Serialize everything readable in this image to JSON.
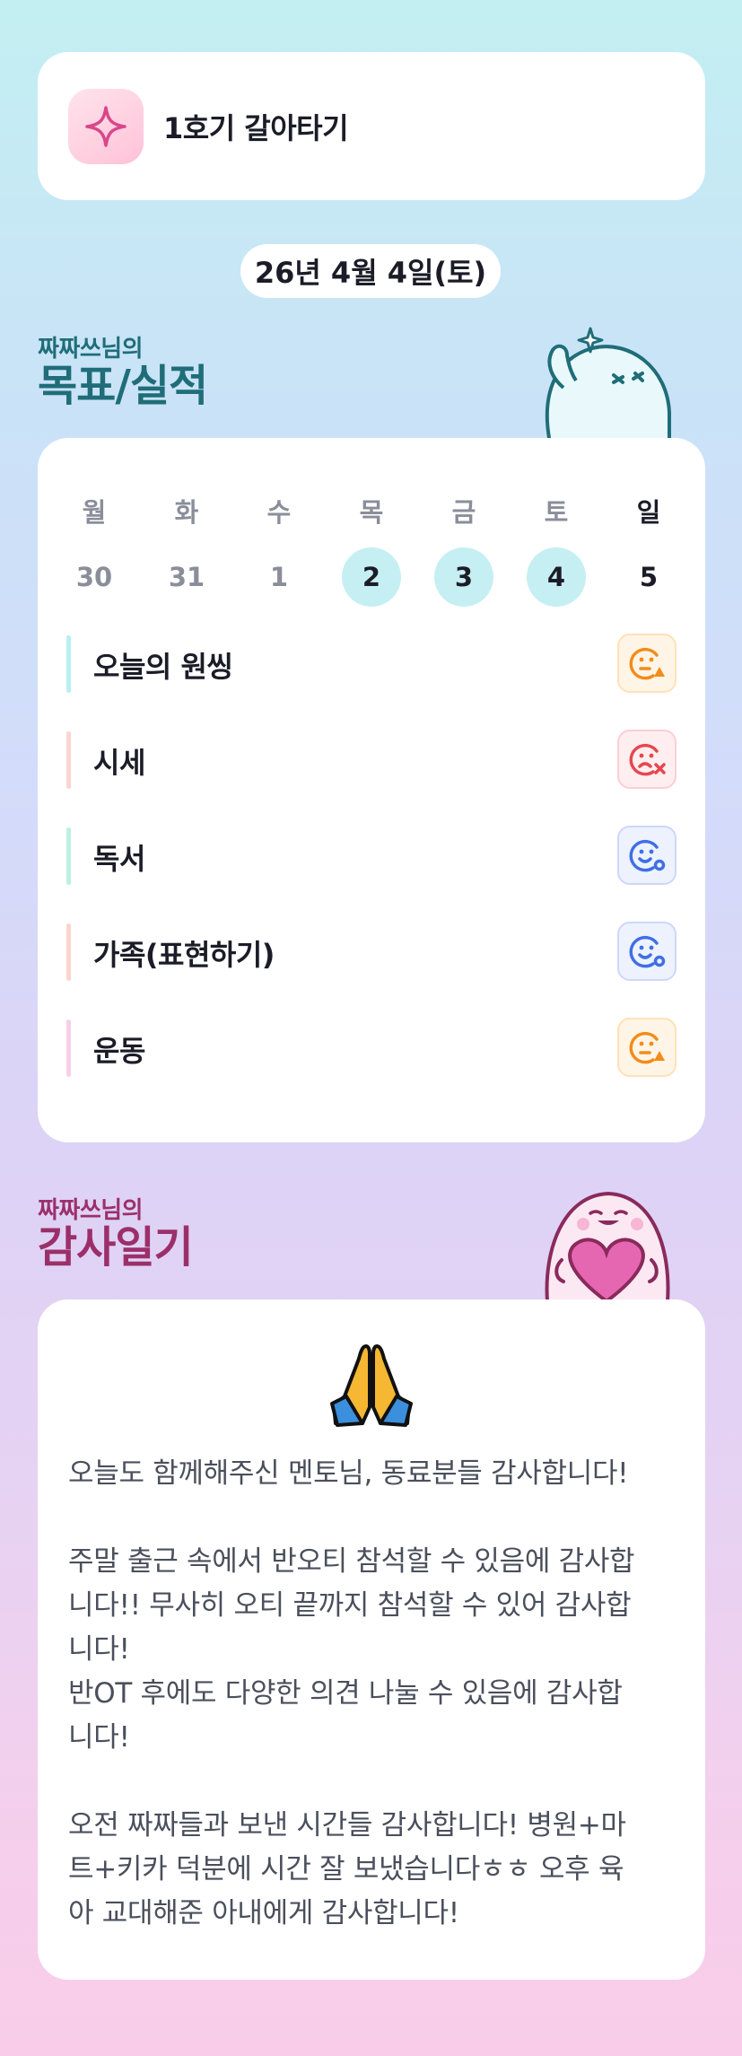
{
  "cohort": {
    "title": "1호기 갈아타기",
    "icon": "sparkle-icon"
  },
  "date_label": "26년 4월 4일(토)",
  "goals_section": {
    "subtitle": "짜짜쓰님의",
    "title": "목표/실적"
  },
  "calendar": {
    "weekdays": [
      "월",
      "화",
      "수",
      "목",
      "금",
      "토",
      "일"
    ],
    "dates": [
      "30",
      "31",
      "1",
      "2",
      "3",
      "4",
      "5"
    ],
    "active_dates": [
      "2",
      "3",
      "4"
    ]
  },
  "goals": [
    {
      "label": "오늘의 원씽",
      "bar_color": "#b9eef3",
      "status": "partial",
      "status_icon": "face-triangle-icon"
    },
    {
      "label": "시세",
      "bar_color": "#fbd4d4",
      "status": "fail",
      "status_icon": "face-x-icon"
    },
    {
      "label": "독서",
      "bar_color": "#bdf0e2",
      "status": "done",
      "status_icon": "face-circle-icon"
    },
    {
      "label": "가족(표현하기)",
      "bar_color": "#fbd4cd",
      "status": "done",
      "status_icon": "face-circle-icon"
    },
    {
      "label": "운동",
      "bar_color": "#f7cfe8",
      "status": "partial",
      "status_icon": "face-triangle-icon"
    }
  ],
  "gratitude_section": {
    "subtitle": "짜짜쓰님의",
    "title": "감사일기"
  },
  "gratitude": {
    "icon": "praying-hands-icon",
    "text": "오늘도 함께해주신 멘토님, 동료분들 감사합니다!\n\n주말 출근 속에서 반오티 참석할 수 있음에 감사합\n니다!! 무사히 오티 끝까지 참석할 수 있어 감사합\n니다!\n반OT 후에도 다양한 의견 나눌 수 있음에 감사합\n니다!\n\n오전 짜짜들과 보낸 시간들 감사합니다! 병원+마\n트+키카 덕분에 시간 잘 보냈습니다ㅎㅎ 오후 육\n아 교대해준 아내에게 감사합니다!"
  },
  "colors": {
    "teal_heading": "#1f6d79",
    "plum_heading": "#9c2f6a",
    "active_date": "#c5eff3",
    "status_orange": "#f28c1a",
    "status_red": "#e5484d",
    "status_blue": "#3f6fe6"
  }
}
